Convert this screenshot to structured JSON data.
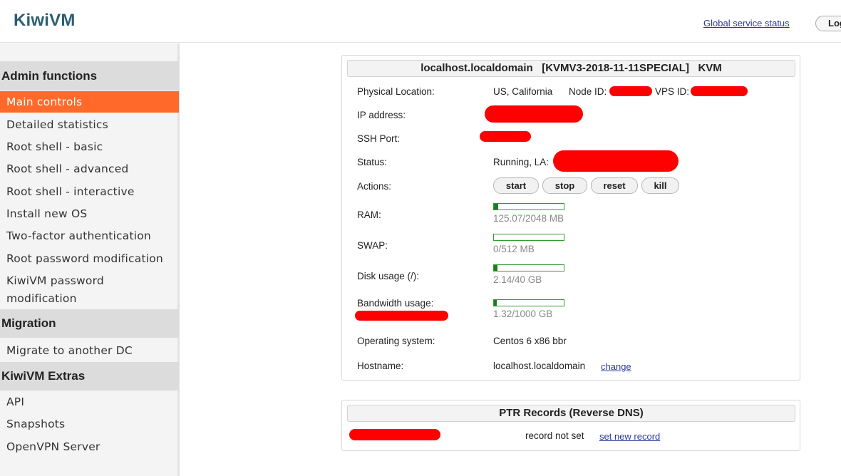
{
  "header": {
    "logo": "KiwiVM",
    "global_status_link": "Global service status",
    "logout_label": "Log"
  },
  "sidebar": {
    "sections": [
      {
        "title": "Admin functions",
        "items": [
          "Main controls",
          "Detailed statistics",
          "Root shell - basic",
          "Root shell - advanced",
          "Root shell - interactive",
          "Install new OS",
          "Two-factor authentication",
          "Root password modification",
          "KiwiVM password modification"
        ]
      },
      {
        "title": "Migration",
        "items": [
          "Migrate to another DC"
        ]
      },
      {
        "title": "KiwiVM Extras",
        "items": [
          "API",
          "Snapshots",
          "OpenVPN Server"
        ]
      }
    ],
    "active_item": "Main controls"
  },
  "info_panel": {
    "title": "localhost.localdomain   [KVMV3-2018-11-11SPECIAL]   KVM",
    "physical_location_label": "Physical Location:",
    "physical_location_value": "US, California",
    "node_id_label": "Node ID:",
    "vps_id_label": "VPS ID:",
    "ip_label": "IP address:",
    "ssh_label": "SSH Port:",
    "status_label": "Status:",
    "status_value": "Running, LA:",
    "actions_label": "Actions:",
    "actions": [
      "start",
      "stop",
      "reset",
      "kill"
    ],
    "ram_label": "RAM:",
    "ram_value": "125.07/2048 MB",
    "ram_fraction": 0.061,
    "swap_label": "SWAP:",
    "swap_value": "0/512 MB",
    "swap_fraction": 0,
    "disk_label": "Disk usage (/):",
    "disk_value": "2.14/40 GB",
    "disk_fraction": 0.0535,
    "bandwidth_label": "Bandwidth usage:",
    "bandwidth_value": "1.32/1000 GB",
    "bandwidth_fraction": 0.00132,
    "os_label": "Operating system:",
    "os_value": "Centos 6 x86 bbr",
    "hostname_label": "Hostname:",
    "hostname_value": "localhost.localdomain",
    "change_link": "change"
  },
  "ptr_panel": {
    "title": "PTR Records (Reverse DNS)",
    "record_status": "record not set",
    "set_link": "set new record"
  },
  "colors": {
    "accent": "#ff6a2a",
    "bar_border": "#2f9a2f",
    "bar_fill": "#1a7f1a",
    "link": "#2a3a9c",
    "redaction": "#ff0000"
  }
}
